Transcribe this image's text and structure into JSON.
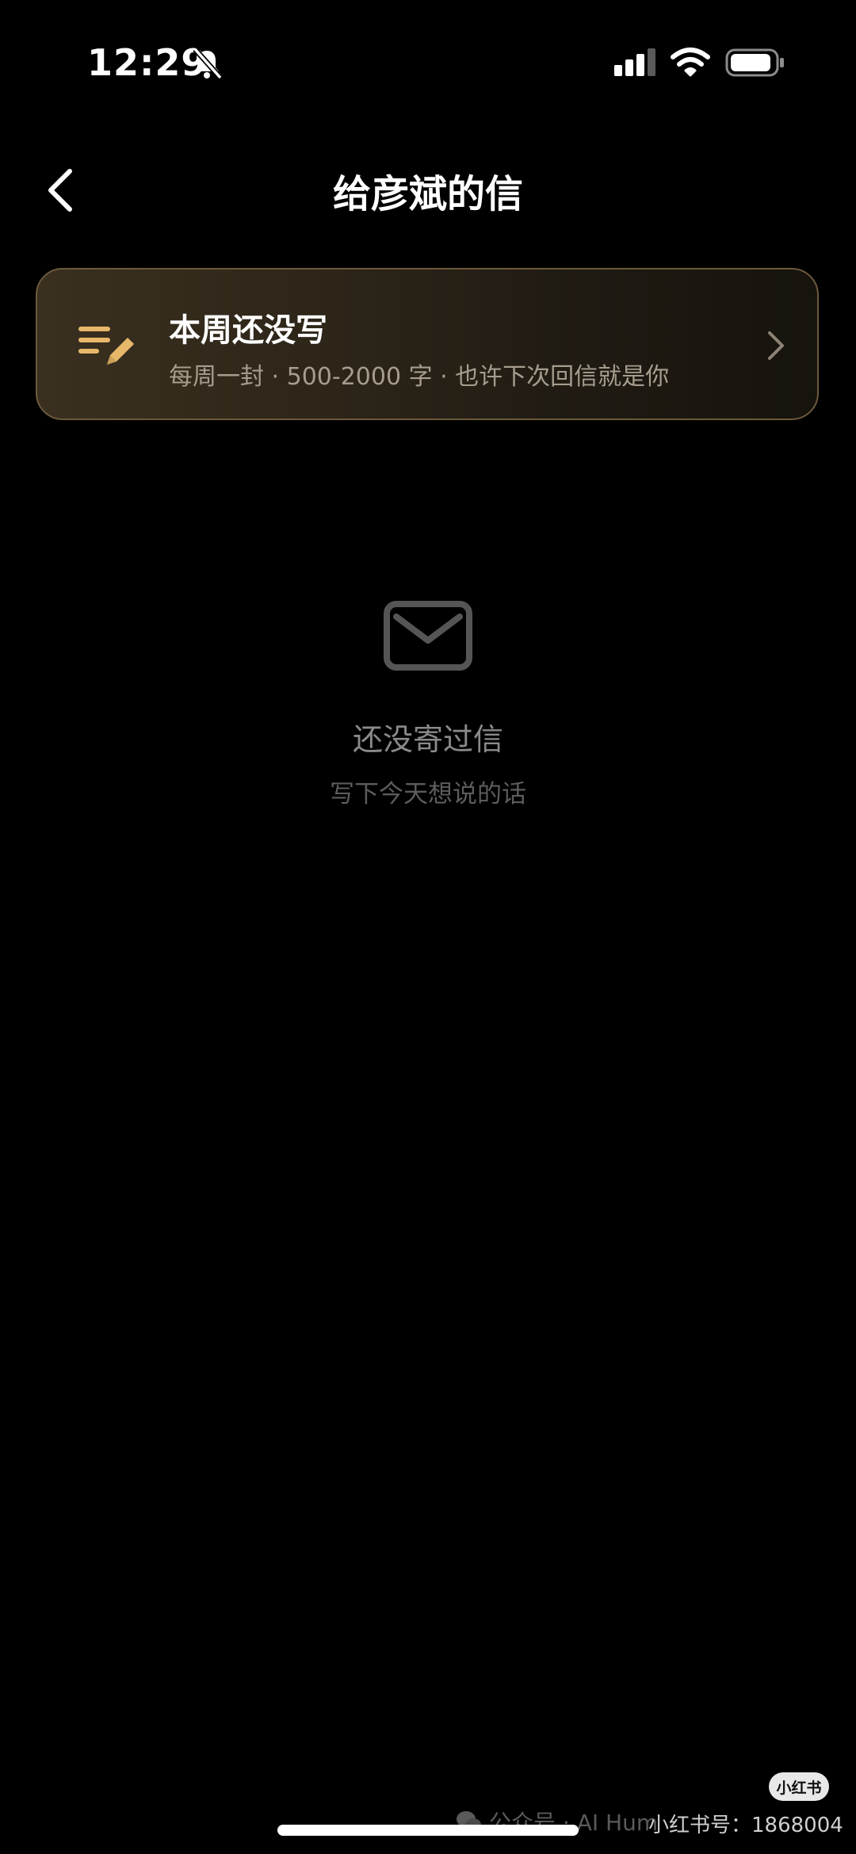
{
  "status_bar": {
    "time": "12:29"
  },
  "header": {
    "title": "给彦斌的信"
  },
  "card": {
    "title": "本周还没写",
    "subtitle": "每周一封 · 500-2000 字 · 也许下次回信就是你",
    "icon": "write-list-icon",
    "accent_color": "#e8b86a"
  },
  "empty_state": {
    "icon": "mail-icon",
    "title": "还没寄过信",
    "subtitle": "写下今天想说的话"
  },
  "watermark": {
    "badge": "小红书",
    "left_text": "公众号 · AI Hum",
    "right_text": "小红书号：1868004"
  },
  "colors": {
    "background": "#000000",
    "card_border": "#6b5a3c",
    "muted_text": "#8a8a8a"
  }
}
